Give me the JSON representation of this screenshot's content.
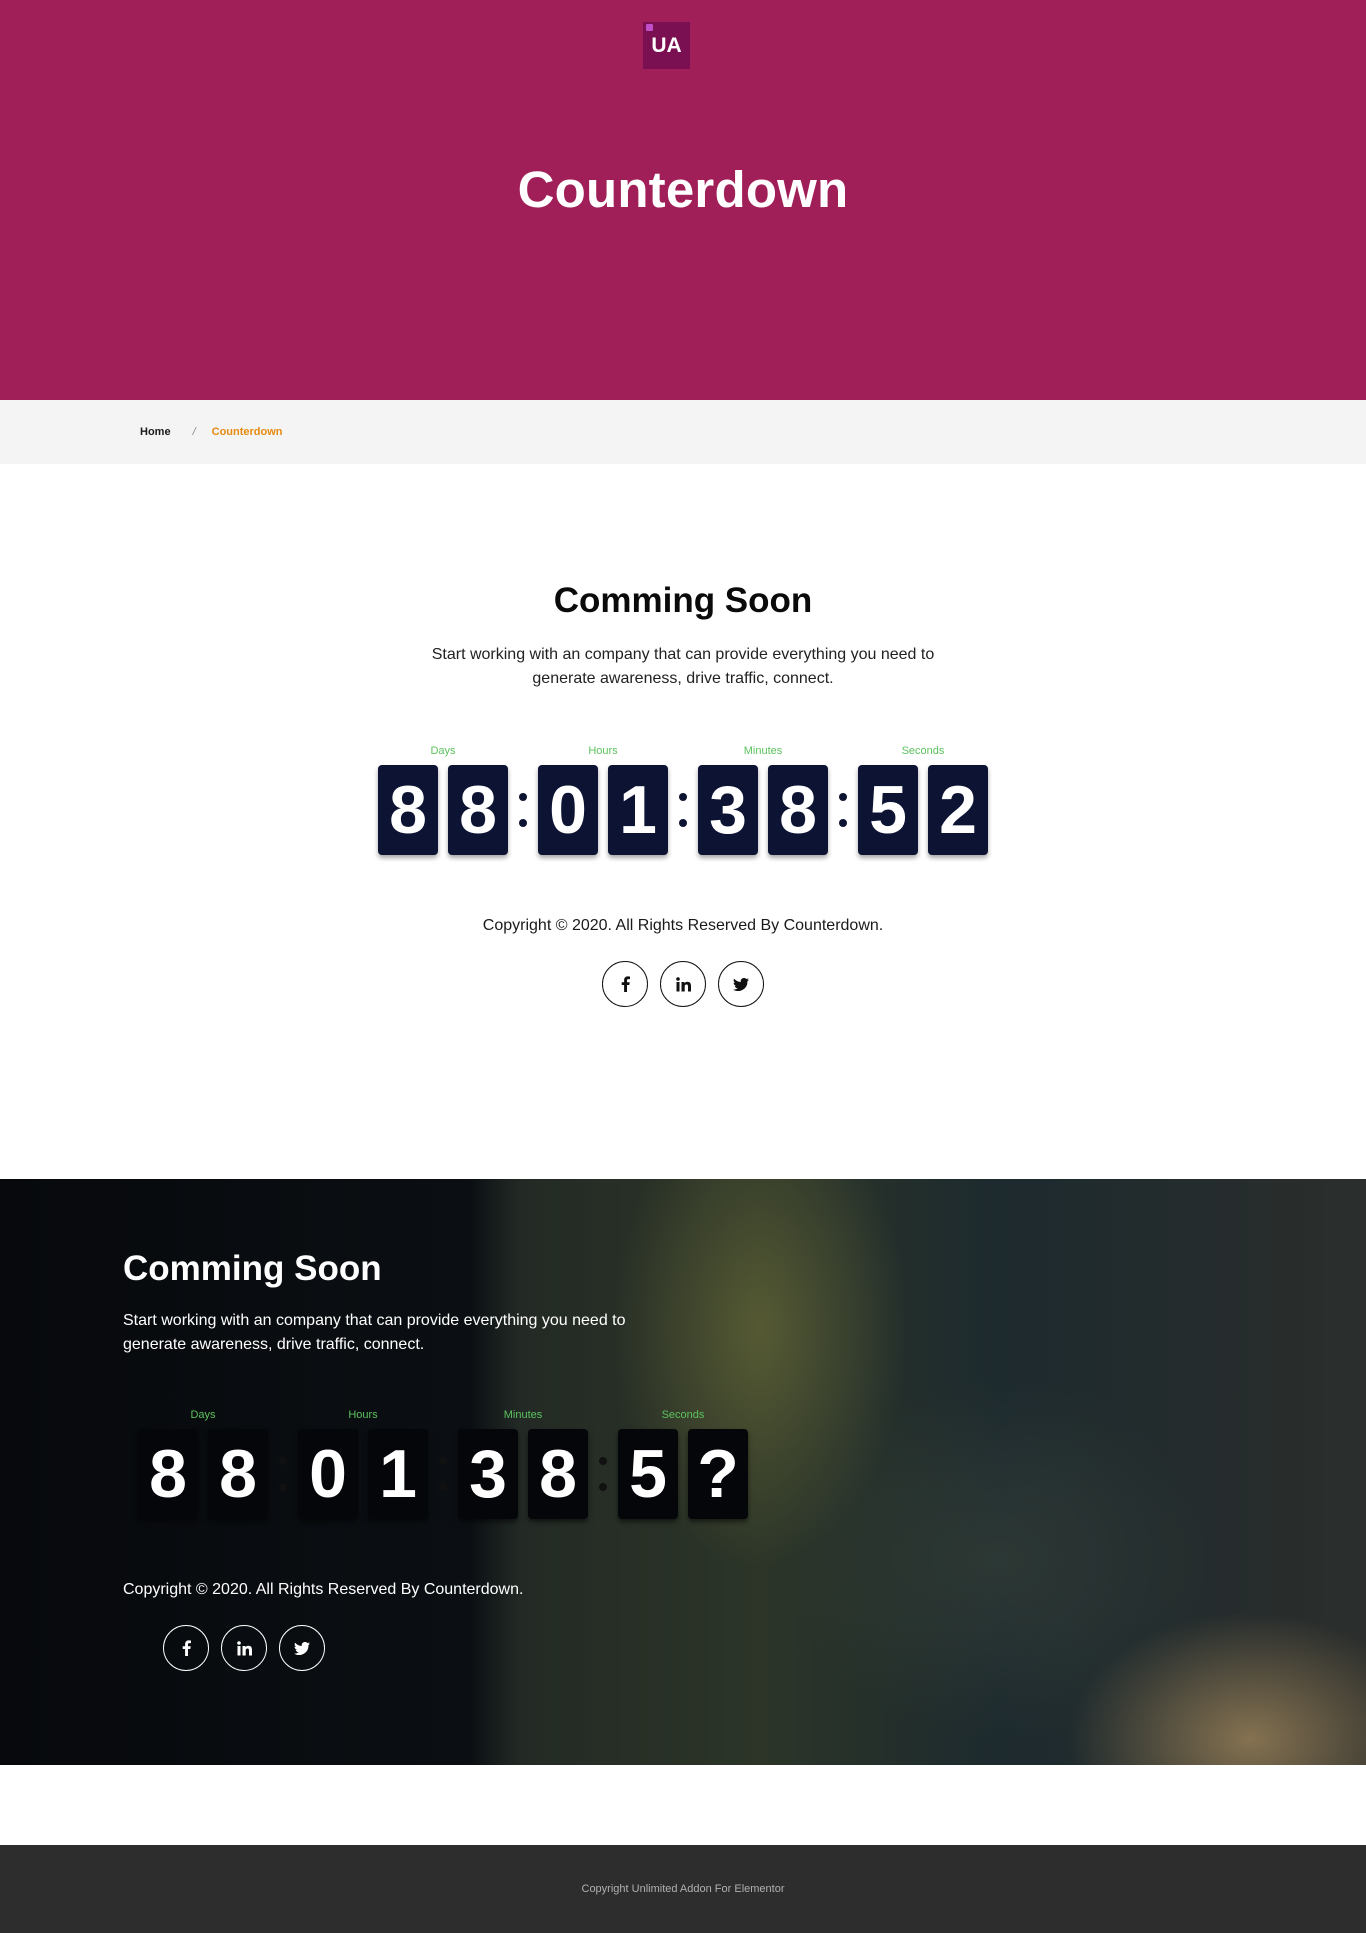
{
  "logo": {
    "text": "UA"
  },
  "hero": {
    "title": "Counterdown"
  },
  "breadcrumb": {
    "home": "Home",
    "separator": "/",
    "current": "Counterdown"
  },
  "section1": {
    "title": "Comming Soon",
    "description": "Start working with an company that can provide everything you need to generate awareness, drive traffic, connect.",
    "labels": {
      "days": "Days",
      "hours": "Hours",
      "minutes": "Minutes",
      "seconds": "Seconds"
    },
    "digits": [
      "8",
      "8",
      "0",
      "1",
      "3",
      "8",
      "5",
      "2"
    ],
    "copyright": "Copyright © 2020. All Rights Reserved By Counterdown.",
    "socials": [
      {
        "icon": "facebook-icon",
        "glyph": "f"
      },
      {
        "icon": "linkedin-icon",
        "glyph": "in"
      },
      {
        "icon": "twitter-icon",
        "glyph": "t"
      }
    ]
  },
  "section2": {
    "title": "Comming Soon",
    "description": "Start working with an company that can provide everything you need to generate awareness, drive traffic, connect.",
    "labels": {
      "days": "Days",
      "hours": "Hours",
      "minutes": "Minutes",
      "seconds": "Seconds"
    },
    "digits": [
      "8",
      "8",
      "0",
      "1",
      "3",
      "8",
      "5",
      "?"
    ],
    "copyright": "Copyright © 2020. All Rights Reserved By Counterdown."
  },
  "footer": {
    "text": "Copyright Unlimited Addon For Elementor"
  },
  "colors": {
    "hero": "#a01f58",
    "accent": "#e58a12",
    "label": "#5cc25e",
    "digit_bg": "#0d1333",
    "footer": "#2d2d2d"
  }
}
